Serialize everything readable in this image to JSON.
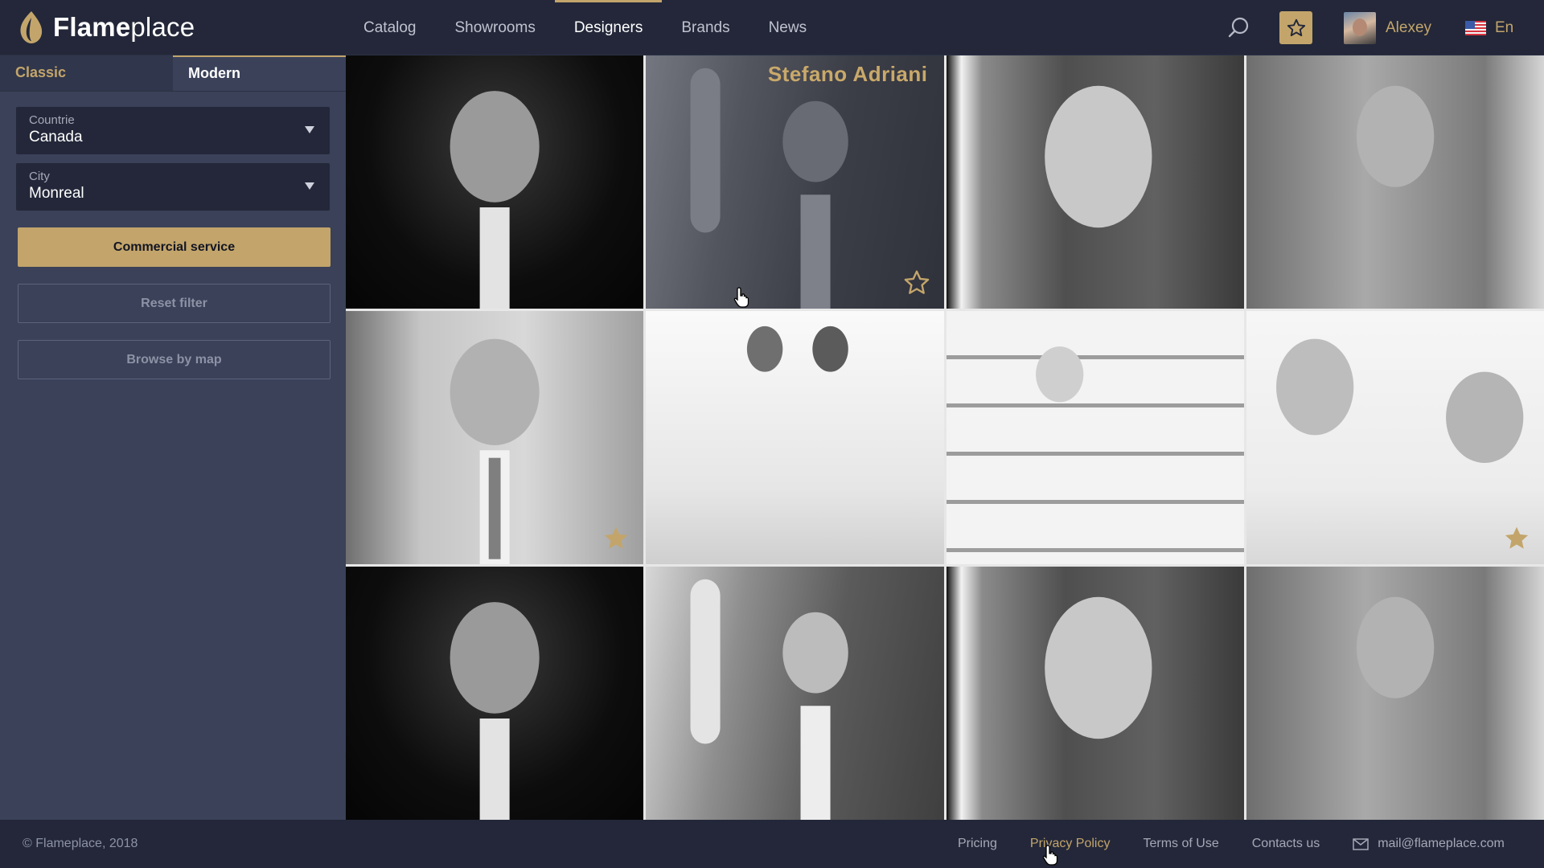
{
  "brand": {
    "name_bold": "Flame",
    "name_light": "place"
  },
  "nav": [
    {
      "label": "Catalog",
      "active": false
    },
    {
      "label": "Showrooms",
      "active": false
    },
    {
      "label": "Designers",
      "active": true
    },
    {
      "label": "Brands",
      "active": false
    },
    {
      "label": "News",
      "active": false
    }
  ],
  "user": {
    "name": "Alexey"
  },
  "language": {
    "label": "En"
  },
  "sidebar": {
    "tabs": [
      {
        "label": "Classic"
      },
      {
        "label": "Modern"
      }
    ],
    "country": {
      "label": "Countrie",
      "value": "Canada"
    },
    "city": {
      "label": "City",
      "value": "Monreal"
    },
    "commercial_button": "Commercial service",
    "reset_button": "Reset filter",
    "map_button": "Browse by map"
  },
  "designers": [
    {
      "name": "",
      "photo": "p1",
      "favorite": "none"
    },
    {
      "name": "Stefano Adriani",
      "photo": "p2",
      "favorite": "outline",
      "hovered": true
    },
    {
      "name": "",
      "photo": "p3",
      "favorite": "none"
    },
    {
      "name": "",
      "photo": "p4",
      "favorite": "none"
    },
    {
      "name": "",
      "photo": "p5",
      "favorite": "filled"
    },
    {
      "name": "",
      "photo": "p6",
      "favorite": "none"
    },
    {
      "name": "",
      "photo": "p7",
      "favorite": "none"
    },
    {
      "name": "",
      "photo": "p8",
      "favorite": "filled"
    },
    {
      "name": "",
      "photo": "p1",
      "favorite": "none"
    },
    {
      "name": "",
      "photo": "p2",
      "favorite": "none"
    },
    {
      "name": "",
      "photo": "p3",
      "favorite": "none"
    },
    {
      "name": "",
      "photo": "p4",
      "favorite": "none"
    }
  ],
  "footer": {
    "copyright": "© Flameplace, 2018",
    "links": [
      {
        "label": "Pricing",
        "active": false
      },
      {
        "label": "Privacy Policy",
        "active": true
      },
      {
        "label": "Terms of Use",
        "active": false
      },
      {
        "label": "Contacts us",
        "active": false
      }
    ],
    "email": "mail@flameplace.com"
  },
  "colors": {
    "accent": "#c3a56b",
    "background": "#232739",
    "sidebar": "#3a4159"
  }
}
